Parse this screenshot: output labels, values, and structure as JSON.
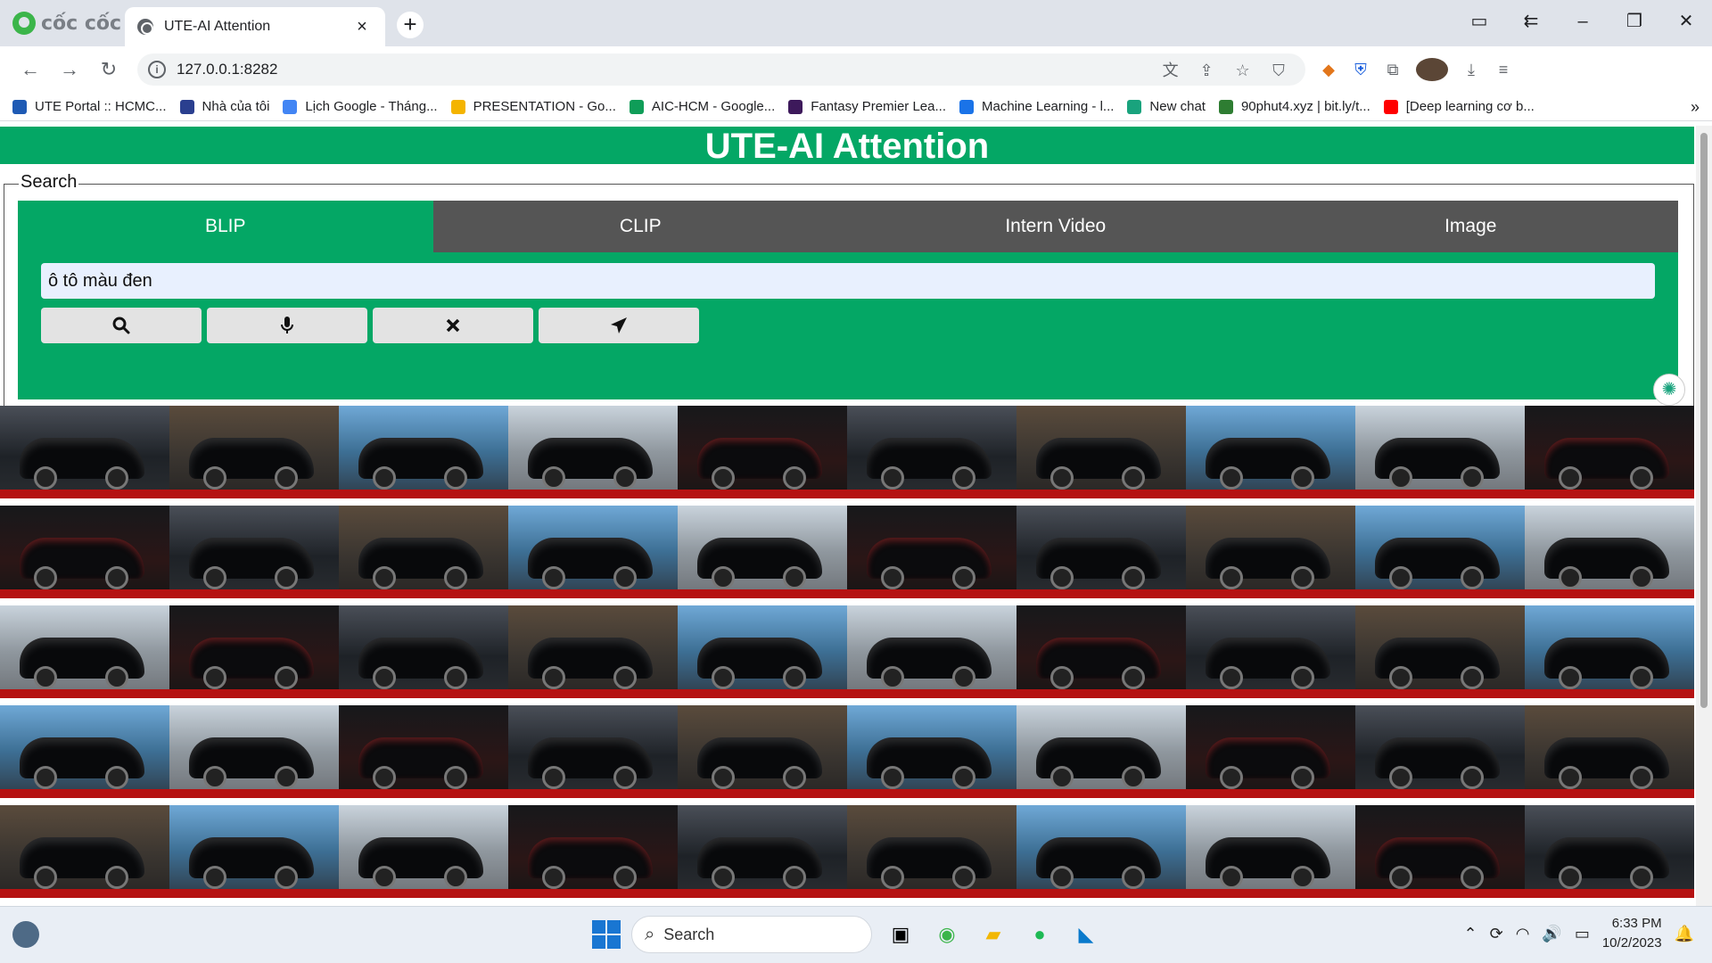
{
  "browser": {
    "brand": "cốc cốc",
    "tab_title": "UTE-AI Attention",
    "tab_close": "×",
    "new_tab": "+",
    "url": "127.0.0.1:8282",
    "window_controls": [
      "▭",
      "⇇",
      "–",
      "❐",
      "✕"
    ],
    "bookmarks": [
      {
        "label": "UTE Portal :: HCMC...",
        "color": "#1e5ab4"
      },
      {
        "label": "Nhà của tôi",
        "color": "#2a3f8f"
      },
      {
        "label": "Lịch Google - Tháng...",
        "color": "#4285f4"
      },
      {
        "label": "PRESENTATION - Go...",
        "color": "#f4b400"
      },
      {
        "label": "AIC-HCM - Google...",
        "color": "#0f9d58"
      },
      {
        "label": "Fantasy Premier Lea...",
        "color": "#3d195b"
      },
      {
        "label": "Machine Learning - l...",
        "color": "#1a73e8"
      },
      {
        "label": "New chat",
        "color": "#19a37d"
      },
      {
        "label": "90phut4.xyz | bit.ly/t...",
        "color": "#2e7d32"
      },
      {
        "label": "[Deep learning cơ b...",
        "color": "#ff0000"
      }
    ],
    "bookmarks_more": "»"
  },
  "app": {
    "title": "UTE-AI Attention",
    "search_legend": "Search",
    "tabs": [
      {
        "label": "BLIP",
        "active": true
      },
      {
        "label": "CLIP",
        "active": false
      },
      {
        "label": "Intern Video",
        "active": false
      },
      {
        "label": "Image",
        "active": false
      }
    ],
    "query_value": "ô tô màu đen",
    "buttons": [
      {
        "name": "search-button",
        "icon": "search-icon",
        "glyph": "🔍"
      },
      {
        "name": "voice-button",
        "icon": "microphone-icon",
        "glyph": "🎤"
      },
      {
        "name": "clear-button",
        "icon": "close-icon",
        "glyph": "✖"
      },
      {
        "name": "send-button",
        "icon": "send-icon",
        "glyph": "➤"
      }
    ],
    "result_rows": 5,
    "result_cols": 10
  },
  "taskbar": {
    "search_label": "Search",
    "time": "6:33 PM",
    "date": "10/2/2023"
  }
}
